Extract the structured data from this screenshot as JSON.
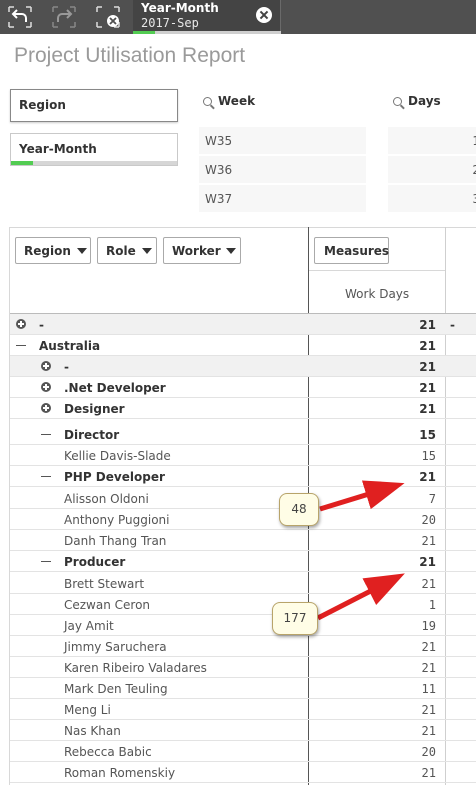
{
  "toolbar": {
    "icons": [
      "step-back-icon",
      "step-forward-icon",
      "clear-selections-icon"
    ],
    "selection": {
      "field": "Year-Month",
      "value": "2017-Sep"
    }
  },
  "page_title": "Project Utilisation Report",
  "filters": {
    "region_label": "Region",
    "year_month_label": "Year-Month"
  },
  "listboxes": {
    "week": {
      "title": "Week",
      "items": [
        "W35",
        "W36",
        "W37"
      ]
    },
    "days": {
      "title": "Days",
      "items": [
        "1",
        "2",
        "3"
      ]
    }
  },
  "pivot": {
    "dimension_buttons": [
      "Region",
      "Role",
      "Worker"
    ],
    "measures_button": "Measures",
    "column_header": "Work Days",
    "rows": [
      {
        "label": "-",
        "value": "21",
        "extra": "-"
      },
      {
        "label": "Australia",
        "value": "21"
      },
      {
        "label": "-",
        "value": "21"
      },
      {
        "label": ".Net Developer",
        "value": "21"
      },
      {
        "label": "Designer",
        "value": "21"
      },
      {
        "label": "Director",
        "value": "15"
      },
      {
        "label": "Kellie Davis-Slade",
        "value": "15"
      },
      {
        "label": "PHP Developer",
        "value": "21"
      },
      {
        "label": "Alisson Oldoni",
        "value": "7"
      },
      {
        "label": "Anthony Puggioni",
        "value": "20"
      },
      {
        "label": "Danh Thang Tran",
        "value": "21"
      },
      {
        "label": "Producer",
        "value": "21"
      },
      {
        "label": "Brett Stewart",
        "value": "21"
      },
      {
        "label": "Cezwan Ceron",
        "value": "1"
      },
      {
        "label": "Jay Amit",
        "value": "19"
      },
      {
        "label": "Jimmy Saruchera",
        "value": "21"
      },
      {
        "label": "Karen Ribeiro Valadares",
        "value": "21"
      },
      {
        "label": "Mark Den Teuling",
        "value": "11"
      },
      {
        "label": "Meng Li",
        "value": "21"
      },
      {
        "label": "Nas Khan",
        "value": "21"
      },
      {
        "label": "Rebecca Babic",
        "value": "20"
      },
      {
        "label": "Roman Romenskiy",
        "value": "21"
      }
    ]
  },
  "annotations": [
    {
      "text": "48"
    },
    {
      "text": "177"
    }
  ],
  "colors": {
    "toolbar": "#505050",
    "selection_green": "#52cc52",
    "arrow_red": "#e02020"
  }
}
